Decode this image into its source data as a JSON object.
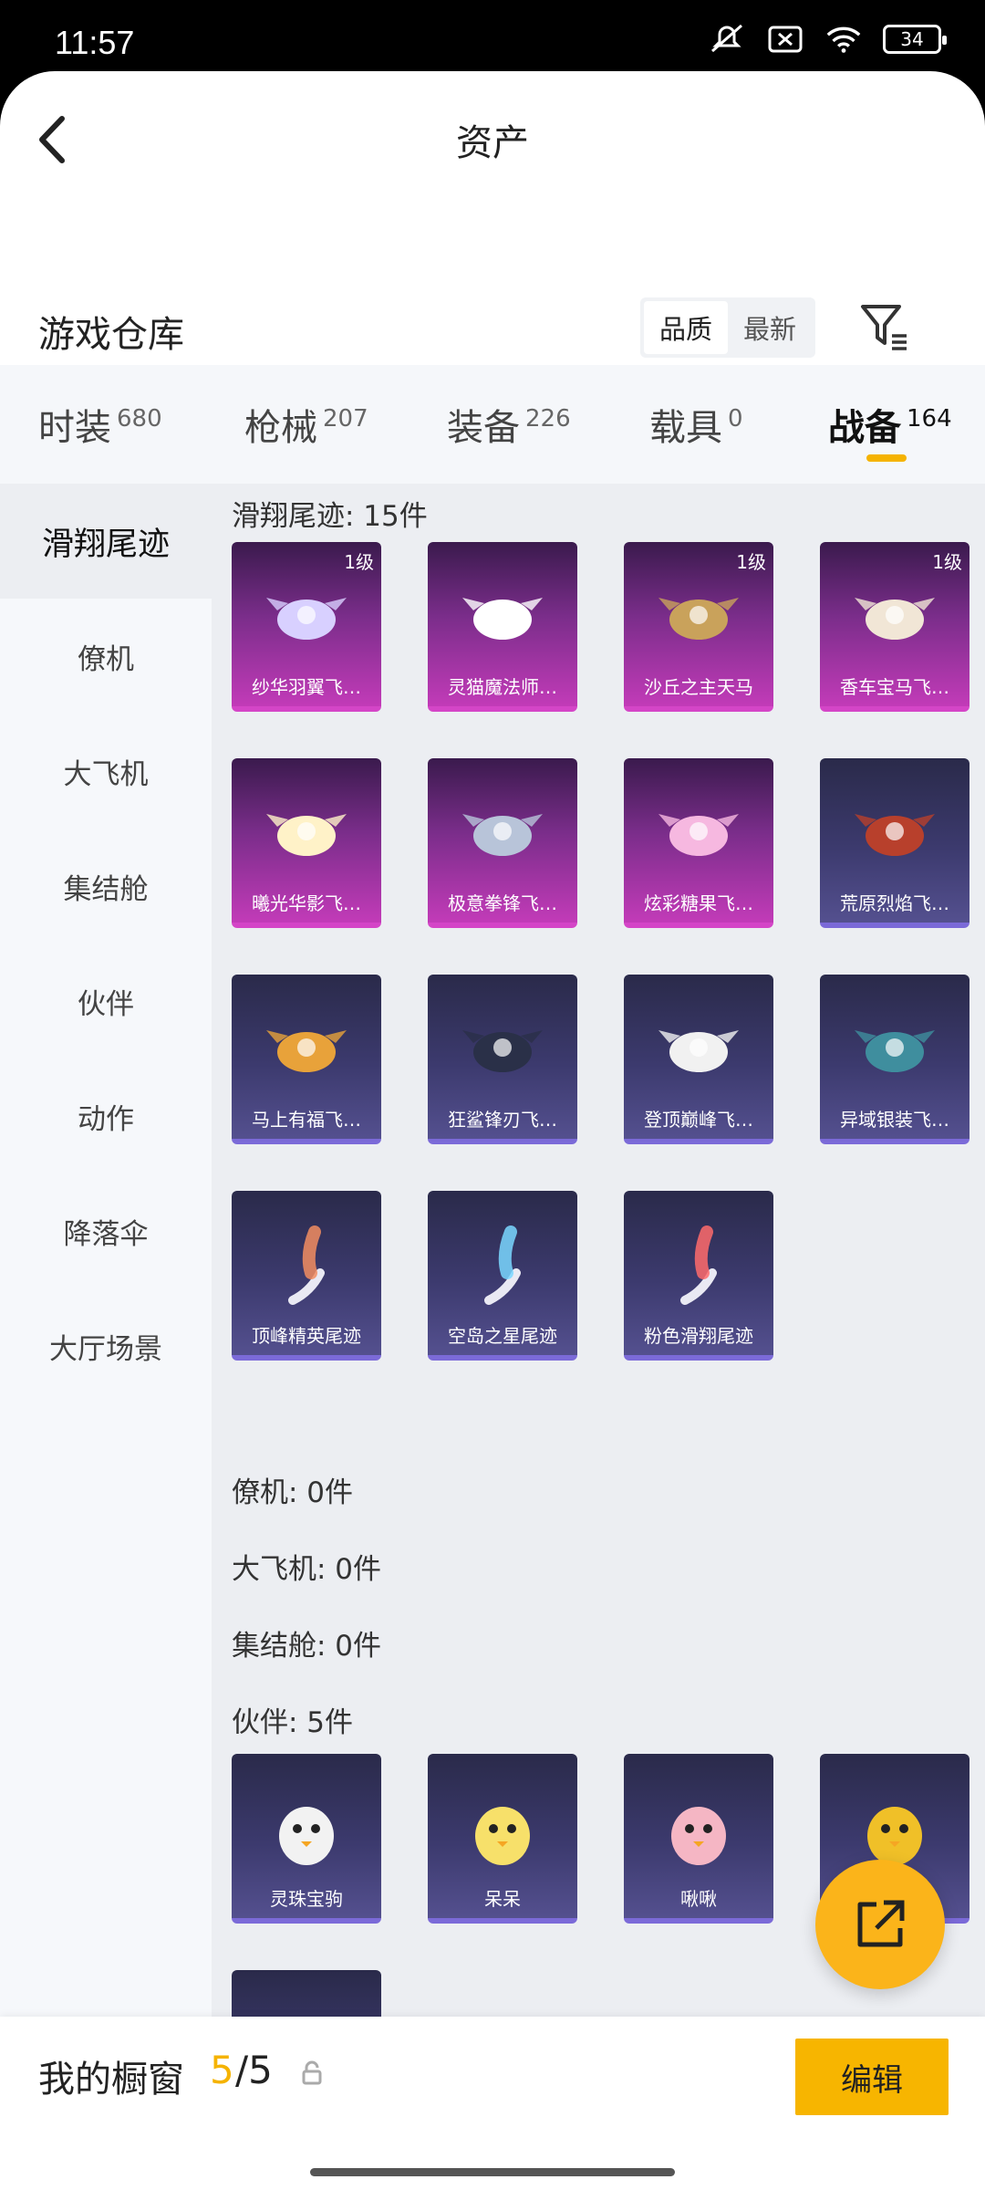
{
  "status_bar": {
    "time": "11:57",
    "battery": "34"
  },
  "header": {
    "title": "资产"
  },
  "section": {
    "title": "游戏仓库",
    "sort_options": [
      "品质",
      "最新"
    ]
  },
  "tabs": [
    {
      "label": "时装",
      "count": "680"
    },
    {
      "label": "枪械",
      "count": "207"
    },
    {
      "label": "装备",
      "count": "226"
    },
    {
      "label": "载具",
      "count": "0"
    },
    {
      "label": "战备",
      "count": "164"
    }
  ],
  "sidebar": [
    "滑翔尾迹",
    "僚机",
    "大飞机",
    "集结舱",
    "伙伴",
    "动作",
    "降落伞",
    "大厅场景"
  ],
  "groups": {
    "trail": {
      "title": "滑翔尾迹: 15件"
    },
    "wingman": {
      "title": "僚机: 0件"
    },
    "bigplane": {
      "title": "大飞机: 0件"
    },
    "assembly": {
      "title": "集结舱: 0件"
    },
    "partner": {
      "title": "伙伴: 5件"
    }
  },
  "trail_items": [
    {
      "name": "纱华羽翼飞…",
      "level": "1级",
      "icon": "wing-glider-icon"
    },
    {
      "name": "灵猫魔法师…",
      "level": "",
      "icon": "cat-glider-icon"
    },
    {
      "name": "沙丘之主天马",
      "level": "1级",
      "icon": "pegasus-chariot-icon"
    },
    {
      "name": "香车宝马飞…",
      "level": "1级",
      "icon": "carriage-glider-icon"
    },
    {
      "name": "曦光华影飞…",
      "level": "",
      "icon": "flower-glider-icon"
    },
    {
      "name": "极意拳锋飞…",
      "level": "",
      "icon": "elephant-glider-icon"
    },
    {
      "name": "炫彩糖果飞…",
      "level": "",
      "icon": "candy-glider-icon"
    },
    {
      "name": "荒原烈焰飞…",
      "level": "",
      "icon": "flame-glider-icon"
    },
    {
      "name": "马上有福飞…",
      "level": "",
      "icon": "horse-glider-icon"
    },
    {
      "name": "狂鲨锋刃飞…",
      "level": "",
      "icon": "shark-glider-icon"
    },
    {
      "name": "登顶巅峰飞…",
      "level": "",
      "icon": "jet-glider-icon"
    },
    {
      "name": "异域银装飞…",
      "level": "",
      "icon": "silver-glider-icon"
    },
    {
      "name": "顶峰精英尾迹",
      "level": "",
      "icon": "smoke-trail-icon"
    },
    {
      "name": "空岛之星尾迹",
      "level": "",
      "icon": "rainbow-trail-icon"
    },
    {
      "name": "粉色滑翔尾迹",
      "level": "",
      "icon": "pink-trail-icon"
    }
  ],
  "partner_items": [
    {
      "name": "灵珠宝驹",
      "icon": "white-dragon-partner-icon"
    },
    {
      "name": "呆呆",
      "icon": "chick-partner-icon"
    },
    {
      "name": "啾啾",
      "icon": "pink-bird-partner-icon"
    },
    {
      "name": "",
      "icon": "rooster-partner-icon"
    },
    {
      "name": "",
      "icon": "helmet-chick-partner-icon"
    }
  ],
  "bottom": {
    "label": "我的橱窗",
    "current": "5",
    "total": "/5",
    "edit_label": "编辑"
  },
  "colors": {
    "accent": "#f5b300",
    "fab": "#fbb41a",
    "epic_card": "#c23bb8",
    "rare_card": "#54508f"
  }
}
